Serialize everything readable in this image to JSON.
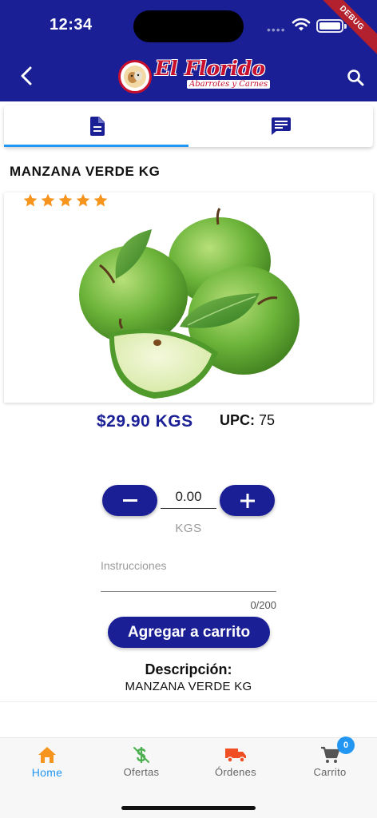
{
  "status_bar": {
    "time": "12:34",
    "signal_dots": "••••",
    "debug_label": "DEBUG"
  },
  "header": {
    "logo_title": "El Florido",
    "logo_subtitle": "Abarrotes y Carnes",
    "back_icon": "chevron-left-icon",
    "search_icon": "search-icon",
    "background_color": "#1a1f96"
  },
  "tabs": [
    {
      "icon": "document-icon",
      "active": true
    },
    {
      "icon": "chat-icon",
      "active": false
    }
  ],
  "product": {
    "title": "MANZANA VERDE KG",
    "rating": 5,
    "price": "$29.90 KGS",
    "upc_label": "UPC:",
    "upc_value": "75"
  },
  "quantity": {
    "value": "0.00",
    "unit": "KGS",
    "minus_symbol": "−",
    "plus_symbol": "+"
  },
  "instructions": {
    "placeholder": "Instrucciones",
    "counter": "0/200"
  },
  "add_to_cart_label": "Agregar a carrito",
  "description": {
    "label": "Descripción:",
    "value": "MANZANA VERDE KG"
  },
  "bottom_nav": [
    {
      "label": "Home",
      "icon": "home-icon",
      "active": true
    },
    {
      "label": "Ofertas",
      "icon": "dollar-icon",
      "active": false
    },
    {
      "label": "Órdenes",
      "icon": "truck-icon",
      "active": false
    },
    {
      "label": "Carrito",
      "icon": "cart-icon",
      "active": false
    }
  ],
  "cart_badge": "0",
  "colors": {
    "primary": "#1a1f96",
    "accent": "#2196f3",
    "star": "#f7941d",
    "orders": "#f04e23",
    "offers": "#4caf50"
  }
}
